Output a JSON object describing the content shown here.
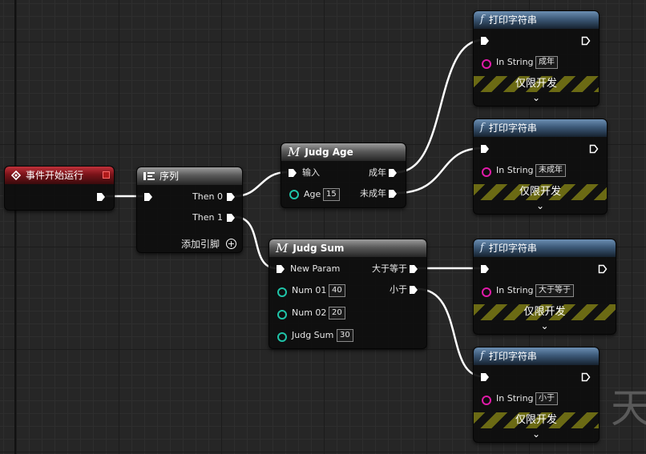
{
  "event_node": {
    "title": "事件开始运行"
  },
  "sequence_node": {
    "title": "序列",
    "then0": "Then 0",
    "then1": "Then 1",
    "add_pin": "添加引脚"
  },
  "judg_age_node": {
    "title": "Judg Age",
    "input": "输入",
    "age_label": "Age",
    "age_value": "15",
    "adult": "成年",
    "minor": "未成年"
  },
  "judg_sum_node": {
    "title": "Judg Sum",
    "new_param": "New Param",
    "num01_label": "Num 01",
    "num01_value": "40",
    "num02_label": "Num 02",
    "num02_value": "20",
    "sum_label": "Judg Sum",
    "sum_value": "30",
    "greater": "大于等于",
    "less": "小于"
  },
  "print_nodes": [
    {
      "title": "打印字符串",
      "in_string_label": "In String",
      "in_string_value": "成年",
      "dev_only": "仅限开发"
    },
    {
      "title": "打印字符串",
      "in_string_label": "In String",
      "in_string_value": "未成年",
      "dev_only": "仅限开发"
    },
    {
      "title": "打印字符串",
      "in_string_label": "In String",
      "in_string_value": "大于等于",
      "dev_only": "仅限开发"
    },
    {
      "title": "打印字符串",
      "in_string_label": "In String",
      "in_string_value": "小于",
      "dev_only": "仅限开发"
    }
  ],
  "watermark": "天",
  "colors": {
    "event_header": "#8a1a20",
    "function_header": "#3c5977",
    "macro_header": "#5a5a5a",
    "teal_pin": "#1fc4a8",
    "string_pin": "#e01aa8",
    "dev_stripe": "#6b6a14"
  },
  "icons": {
    "event": "event-diamond-icon",
    "sequence": "sequence-icon",
    "macro": "macro-m-icon",
    "function": "function-f-icon"
  }
}
